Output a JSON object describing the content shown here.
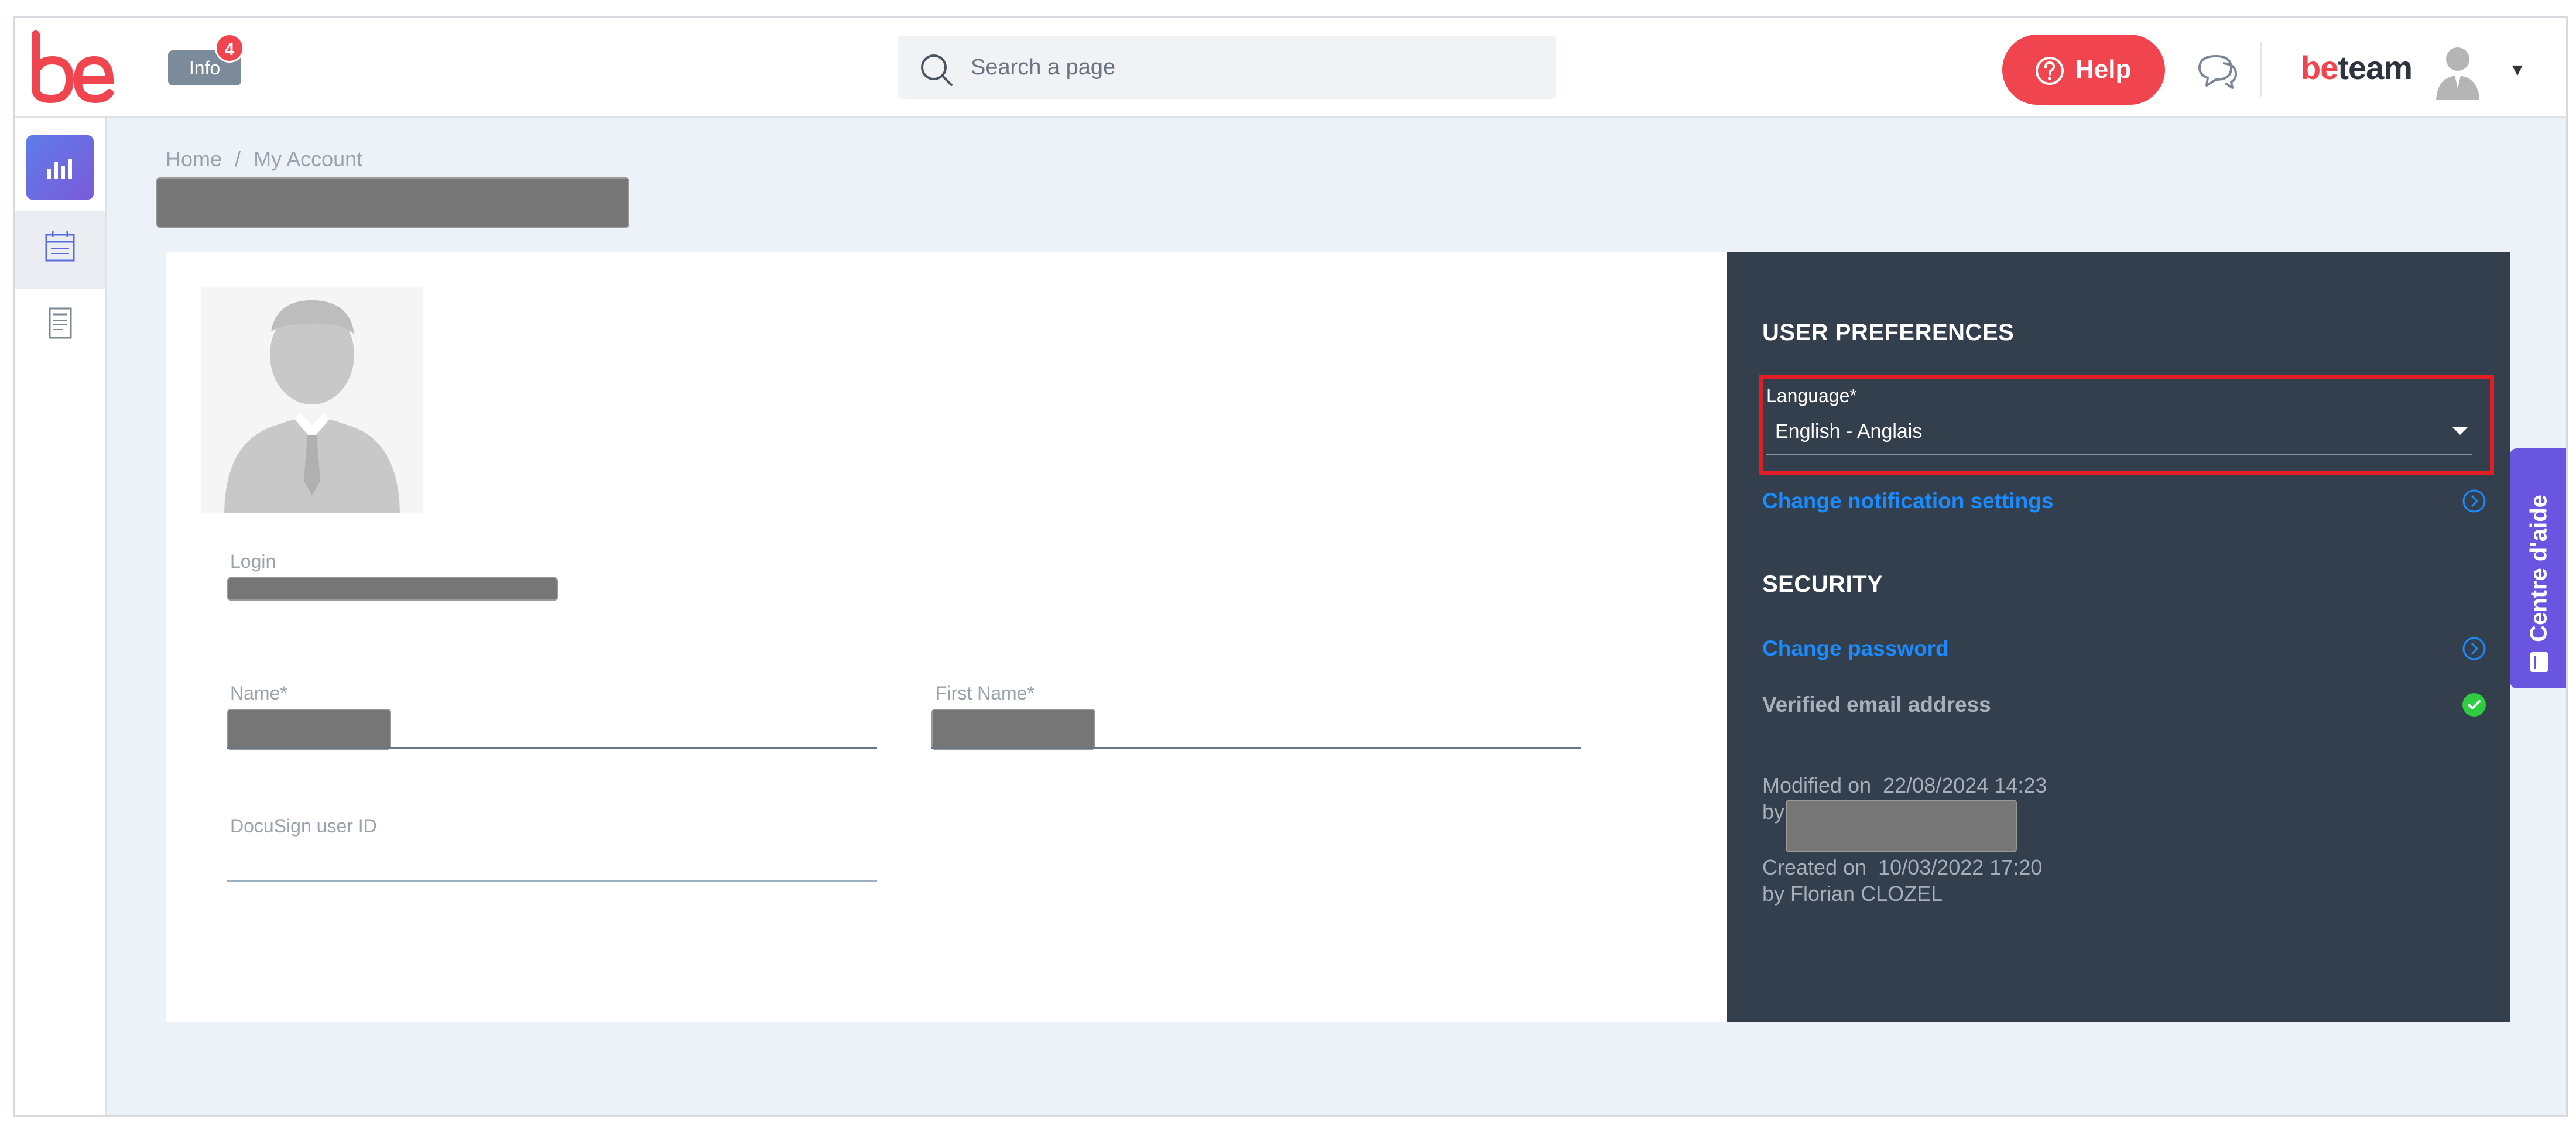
{
  "header": {
    "info_label": "Info",
    "info_count": "4",
    "search_placeholder": "Search a page",
    "help_label": "Help",
    "brand_be": "be",
    "brand_team": "team"
  },
  "sidebar": {
    "items": [
      {
        "name": "dashboard",
        "icon": "bar-chart-icon"
      },
      {
        "name": "calendar",
        "icon": "calendar-icon"
      },
      {
        "name": "report",
        "icon": "document-icon"
      }
    ]
  },
  "breadcrumb": {
    "home": "Home",
    "separator": "/",
    "current": "My Account"
  },
  "account": {
    "login_label": "Login",
    "name_label": "Name*",
    "first_name_label": "First Name*",
    "docusign_label": "DocuSign user ID"
  },
  "preferences": {
    "title": "USER PREFERENCES",
    "language_label": "Language*",
    "language_value": "English - Anglais",
    "notification_link": "Change notification settings"
  },
  "security": {
    "title": "SECURITY",
    "change_password": "Change password",
    "verified_email": "Verified email address"
  },
  "meta": {
    "modified_label": "Modified on",
    "modified_date": "22/08/2024 14:23",
    "by_label": "by",
    "created_label": "Created on",
    "created_date": "10/03/2022 17:20",
    "created_by": "by Florian CLOZEL"
  },
  "help_tab": {
    "label": "Centre d'aide"
  },
  "colors": {
    "brand_red": "#f0454f",
    "panel_bg": "#343f4e",
    "link_blue": "#1a8cff",
    "help_tab_purple": "#6a55e0",
    "highlight_red": "#e01e23",
    "verified_green": "#2ecc40"
  }
}
